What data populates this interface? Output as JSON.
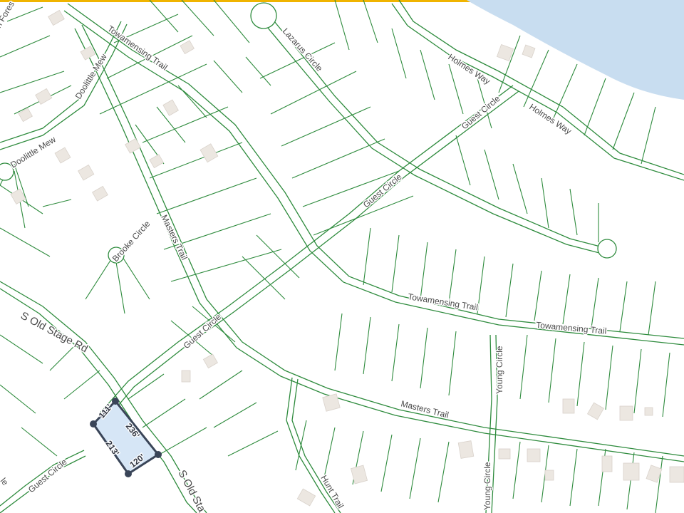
{
  "colors": {
    "parcel_line": "#2e8b3d",
    "water": "#c8ddf0",
    "top_bar": "#f0b400",
    "selected_fill": "#d6e6f6",
    "selected_outline": "#3a4558",
    "building": "#ece7e1"
  },
  "streets": {
    "forest": "n Fores",
    "towamensing_trail": "Towamensing Trail",
    "lazarus_circle": "Lazarus Circle",
    "holmes_way": "Holmes Way",
    "doolittle_mew": "Doolittle Mew",
    "guest_circle": "Guest Circle",
    "brooke_circle": "Brooke Circle",
    "masters_trail": "Masters Trail",
    "s_old_stage_rd": "S Old Stage Rd",
    "s_old_sta": "S Old Sta",
    "young_circle": "Young Circle",
    "hunt_trail": "Hunt Trail",
    "edge_le": "le"
  },
  "selected_parcel": {
    "dimensions": {
      "north": "111'",
      "east": "236'",
      "west": "213'",
      "south": "120'"
    }
  }
}
